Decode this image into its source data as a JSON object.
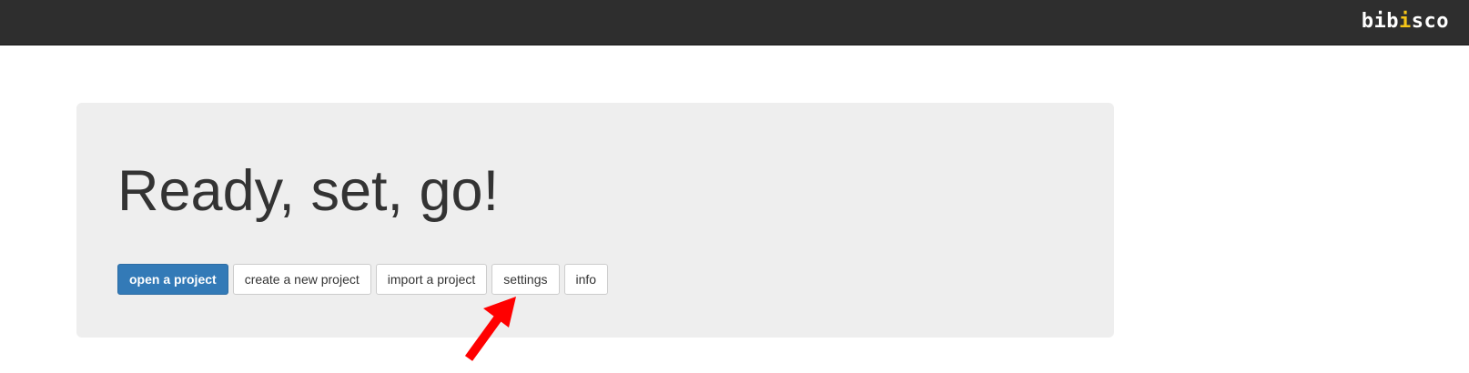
{
  "header": {
    "brand": {
      "parts": [
        "bib",
        "i",
        "sco"
      ],
      "accent_color": "#f5c518"
    },
    "background_color": "#2e2e2e"
  },
  "main": {
    "headline": "Ready, set, go!",
    "buttons": [
      {
        "label": "open a project",
        "style": "primary"
      },
      {
        "label": "create a new project",
        "style": "default"
      },
      {
        "label": "import a project",
        "style": "default"
      },
      {
        "label": "settings",
        "style": "default"
      },
      {
        "label": "info",
        "style": "default"
      }
    ]
  },
  "annotation": {
    "icon": "red-arrow-icon",
    "color": "#ff0000",
    "points_to": "settings"
  }
}
